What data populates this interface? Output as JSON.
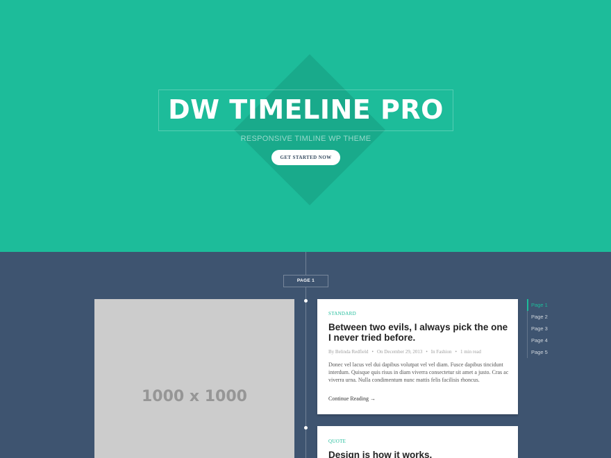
{
  "hero": {
    "title": "DW TIMELINE PRO",
    "subtitle": "RESPONSIVE TIMLINE WP THEME",
    "cta_label": "GET STARTED NOW"
  },
  "timeline": {
    "page_badge": "PAGE 1",
    "placeholder_image_label": "1000 x 1000"
  },
  "posts": [
    {
      "category": "STANDARD",
      "title": "Between two evils, I always pick the one I never tried before.",
      "meta": {
        "author": "By Belinda Redfield",
        "date": "On December 29, 2013",
        "category": "In Fashion",
        "read_time": "1 min read"
      },
      "excerpt": "Donec vel lacus vel dui dapibus volutpat vel vel diam. Fusce dapibus tincidunt interdum. Quisque quis risus in diam viverra consectetur sit amet a justo. Cras ac viverra urna. Nulla condimentum nunc mattis felis facilisis rhoncus.",
      "continue_label": "Continue Reading →"
    },
    {
      "category": "QUOTE",
      "title": "Design is how it works."
    }
  ],
  "page_nav": {
    "items": [
      "Page 1",
      "Page 2",
      "Page 3",
      "Page 4",
      "Page 5"
    ],
    "active_index": 0
  },
  "colors": {
    "hero_bg": "#1dbc9a",
    "timeline_bg": "#3e5470",
    "accent": "#1dbc9a",
    "placeholder": "#cccccc"
  }
}
